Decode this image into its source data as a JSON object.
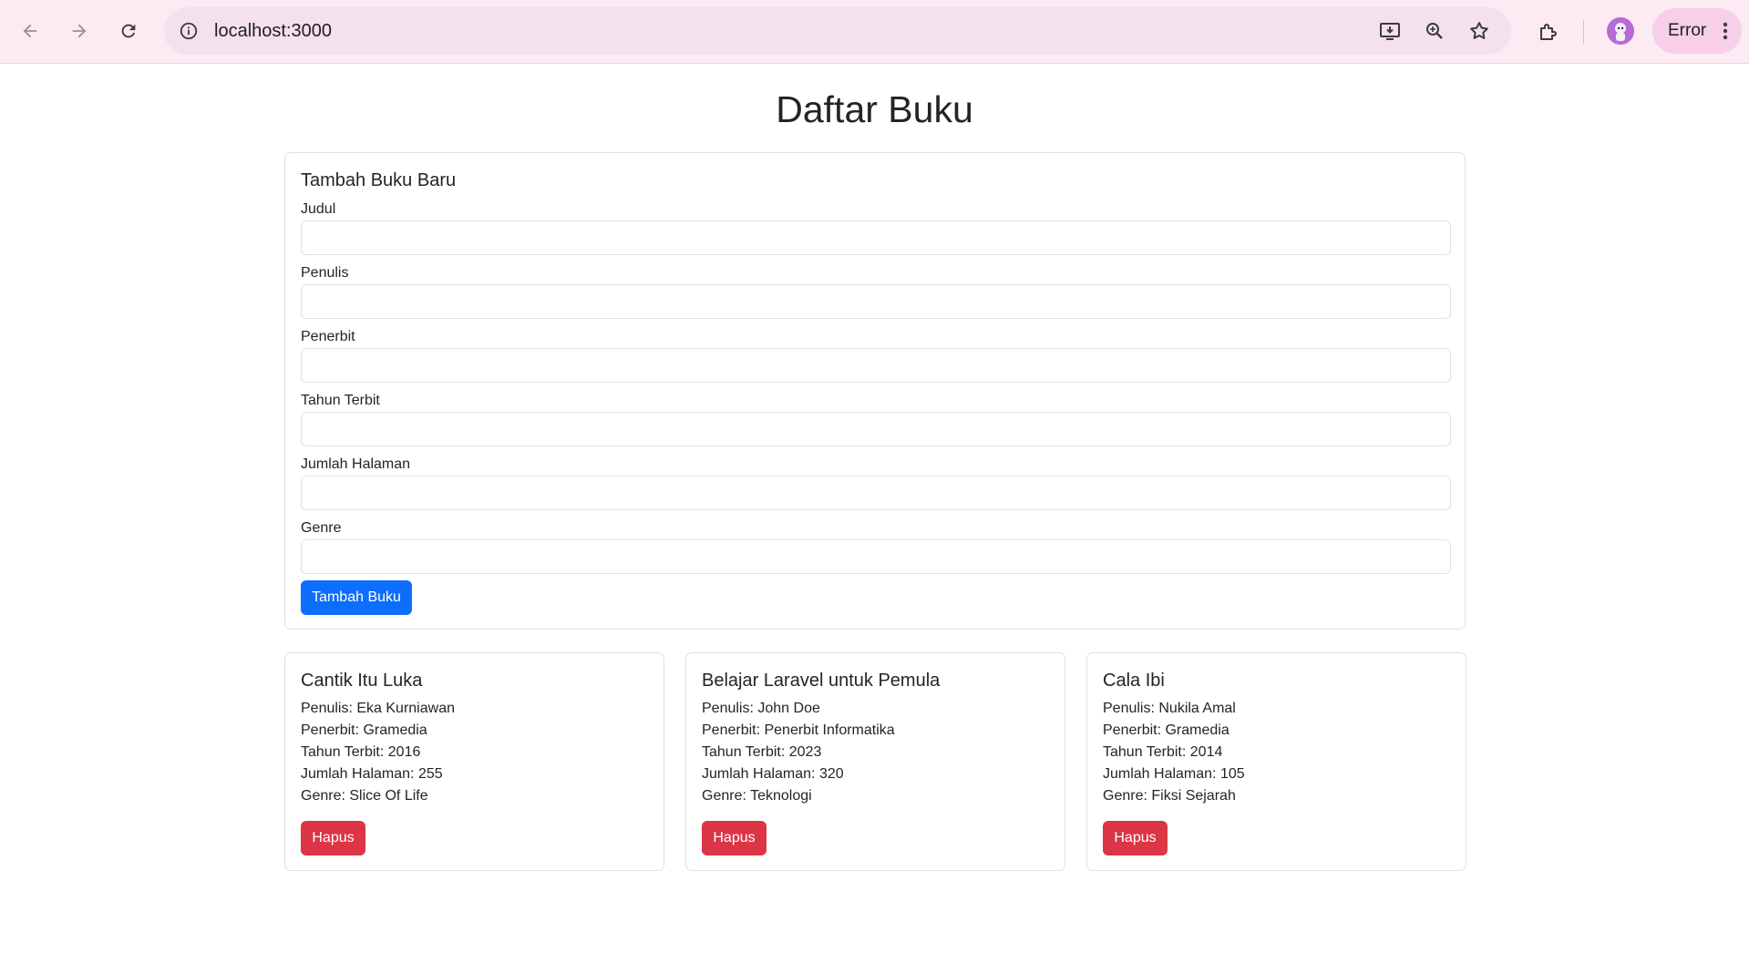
{
  "browser": {
    "url": "localhost:3000",
    "profile_status": "Error",
    "icons": {
      "back": "arrow-left-icon",
      "forward": "arrow-right-icon",
      "reload": "reload-icon",
      "site_info": "info-icon",
      "install": "install-app-icon",
      "zoom": "zoom-icon",
      "bookmark": "star-icon",
      "extensions": "puzzle-icon",
      "menu": "kebab-menu-icon"
    }
  },
  "page": {
    "title": "Daftar Buku"
  },
  "form": {
    "title": "Tambah Buku Baru",
    "fields": [
      {
        "label": "Judul",
        "value": "",
        "placeholder": ""
      },
      {
        "label": "Penulis",
        "value": "",
        "placeholder": ""
      },
      {
        "label": "Penerbit",
        "value": "",
        "placeholder": ""
      },
      {
        "label": "Tahun Terbit",
        "value": "",
        "placeholder": ""
      },
      {
        "label": "Jumlah Halaman",
        "value": "",
        "placeholder": ""
      },
      {
        "label": "Genre",
        "value": "",
        "placeholder": ""
      }
    ],
    "submit_label": "Tambah Buku"
  },
  "books": [
    {
      "title": "Cantik Itu Luka",
      "penulis": "Penulis: Eka Kurniawan",
      "penerbit": "Penerbit: Gramedia",
      "tahun": "Tahun Terbit: 2016",
      "halaman": "Jumlah Halaman: 255",
      "genre": "Genre: Slice Of Life",
      "delete_label": "Hapus"
    },
    {
      "title": "Belajar Laravel untuk Pemula",
      "penulis": "Penulis: John Doe",
      "penerbit": "Penerbit: Penerbit Informatika",
      "tahun": "Tahun Terbit: 2023",
      "halaman": "Jumlah Halaman: 320",
      "genre": "Genre: Teknologi",
      "delete_label": "Hapus"
    },
    {
      "title": "Cala Ibi",
      "penulis": "Penulis: Nukila Amal",
      "penerbit": "Penerbit: Gramedia",
      "tahun": "Tahun Terbit: 2014",
      "halaman": "Jumlah Halaman: 105",
      "genre": "Genre: Fiksi Sejarah",
      "delete_label": "Hapus"
    }
  ],
  "colors": {
    "primary": "#0d6efd",
    "danger": "#dc3545",
    "border": "#dee2e6",
    "chrome_bg": "#fcebf3"
  }
}
